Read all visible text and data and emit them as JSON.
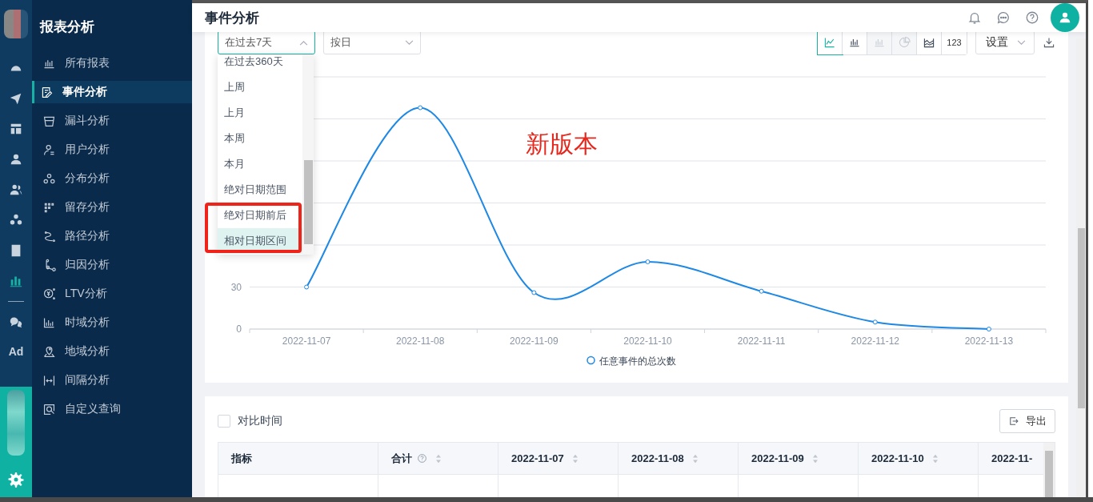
{
  "sidebar": {
    "title": "报表分析",
    "rail": [
      {
        "kind": "icon",
        "selected": false
      },
      {
        "kind": "icon",
        "selected": false
      },
      {
        "kind": "icon",
        "selected": false
      },
      {
        "kind": "icon",
        "selected": false
      },
      {
        "kind": "icon",
        "selected": false
      },
      {
        "kind": "icon",
        "selected": false
      },
      {
        "kind": "icon",
        "selected": false
      },
      {
        "kind": "icon",
        "selected": true
      },
      {
        "kind": "icon",
        "selected": false
      },
      {
        "kind": "text",
        "label": "Ad",
        "selected": false
      }
    ],
    "items": [
      {
        "label": "所有报表",
        "selected": false
      },
      {
        "label": "事件分析",
        "selected": true
      },
      {
        "label": "漏斗分析",
        "selected": false
      },
      {
        "label": "用户分析",
        "selected": false
      },
      {
        "label": "分布分析",
        "selected": false
      },
      {
        "label": "留存分析",
        "selected": false
      },
      {
        "label": "路径分析",
        "selected": false
      },
      {
        "label": "归因分析",
        "selected": false
      },
      {
        "label": "LTV分析",
        "selected": false
      },
      {
        "label": "时域分析",
        "selected": false
      },
      {
        "label": "地域分析",
        "selected": false
      },
      {
        "label": "间隔分析",
        "selected": false
      },
      {
        "label": "自定义查询",
        "selected": false
      }
    ]
  },
  "header": {
    "title": "事件分析"
  },
  "filters": {
    "range": {
      "value": "在过去7天",
      "expanded": true,
      "options": [
        {
          "label": "在过去360天",
          "selected": false
        },
        {
          "label": "上周",
          "selected": false
        },
        {
          "label": "上月",
          "selected": false
        },
        {
          "label": "本周",
          "selected": false
        },
        {
          "label": "本月",
          "selected": false
        },
        {
          "label": "绝对日期范围",
          "selected": false
        },
        {
          "label": "绝对日期前后",
          "selected": false
        },
        {
          "label": "相对日期区间",
          "selected": true
        }
      ]
    },
    "granularity": {
      "value": "按日"
    }
  },
  "chart_types": [
    {
      "kind": "line",
      "selected": true,
      "disabled": false
    },
    {
      "kind": "bar",
      "selected": false,
      "disabled": false
    },
    {
      "kind": "bar",
      "selected": false,
      "disabled": true
    },
    {
      "kind": "pie",
      "selected": false,
      "disabled": true
    },
    {
      "kind": "area",
      "selected": false,
      "disabled": false
    },
    {
      "kind": "text",
      "label": "123",
      "selected": false,
      "disabled": false
    }
  ],
  "settings": {
    "label": "设置"
  },
  "annotation": {
    "text": "新版本"
  },
  "chart": {
    "chart_data": {
      "type": "line",
      "categories": [
        "2022-11-07",
        "2022-11-08",
        "2022-11-09",
        "2022-11-10",
        "2022-11-11",
        "2022-11-12",
        "2022-11-13"
      ],
      "series": [
        {
          "name": "任意事件的总次数",
          "color": "#1e88e5",
          "marker": true,
          "values": [
            30,
            158,
            26,
            48,
            27,
            5,
            0
          ]
        }
      ],
      "ylim": [
        0,
        180
      ],
      "yticks": [
        0,
        30
      ]
    }
  },
  "table": {
    "compare": {
      "label": "对比时间",
      "checked": false
    },
    "export": "导出",
    "columns": [
      {
        "label": "指标",
        "sortable": false,
        "help": false
      },
      {
        "label": "合计",
        "sortable": true,
        "help": true
      },
      {
        "label": "2022-11-07",
        "sortable": true,
        "help": false
      },
      {
        "label": "2022-11-08",
        "sortable": true,
        "help": false
      },
      {
        "label": "2022-11-09",
        "sortable": true,
        "help": false
      },
      {
        "label": "2022-11-10",
        "sortable": true,
        "help": false
      },
      {
        "label": "2022-11-",
        "sortable": false,
        "help": false
      }
    ]
  }
}
